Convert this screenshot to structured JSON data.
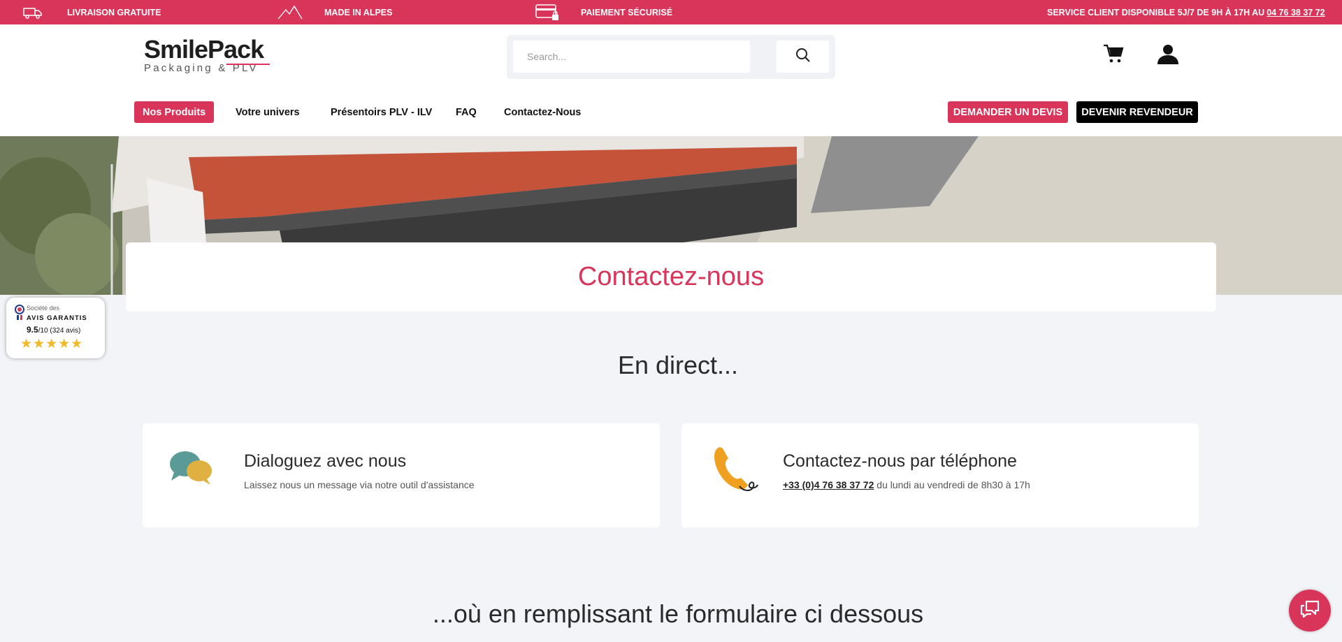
{
  "topbar": {
    "shipping": "LIVRAISON GRATUITE",
    "made_in": "MADE IN ALPES",
    "payment": "PAIEMENT SÉCURISÉ",
    "service_prefix": "SERVICE CLIENT DISPONIBLE 5J/7 DE 9H À 17H AU ",
    "service_phone": "04 76 38 37 72"
  },
  "header": {
    "logo_line1": "SmilePack",
    "logo_line2": "Packaging & PLV",
    "search_placeholder": "Search..."
  },
  "nav": {
    "items": [
      "Nos Produits",
      "Votre univers",
      "Présentoirs PLV - ILV",
      "FAQ",
      "Contactez-Nous"
    ],
    "quote_button": "DEMANDER UN DEVIS",
    "reseller_button": "DEVENIR REVENDEUR"
  },
  "page": {
    "title": "Contactez-nous",
    "section1": "En direct...",
    "section2": "...où en remplissant le formulaire ci dessous"
  },
  "badge": {
    "line1": "Société des",
    "line2": "AVIS GARANTIS",
    "score": "9.5",
    "score_suffix": "/10 (324 avis)",
    "stars": "★★★★★"
  },
  "cards": [
    {
      "title": "Dialoguez avec nous",
      "subtitle": "Laissez nous un message via notre outil d'assistance"
    },
    {
      "title": "Contactez-nous par téléphone",
      "phone": "+33 (0)4 76 38 37 72",
      "subtitle": " du lundi au vendredi de 8h30 à 17h"
    }
  ],
  "colors": {
    "brand": "#d9345a",
    "dark": "#000000"
  }
}
